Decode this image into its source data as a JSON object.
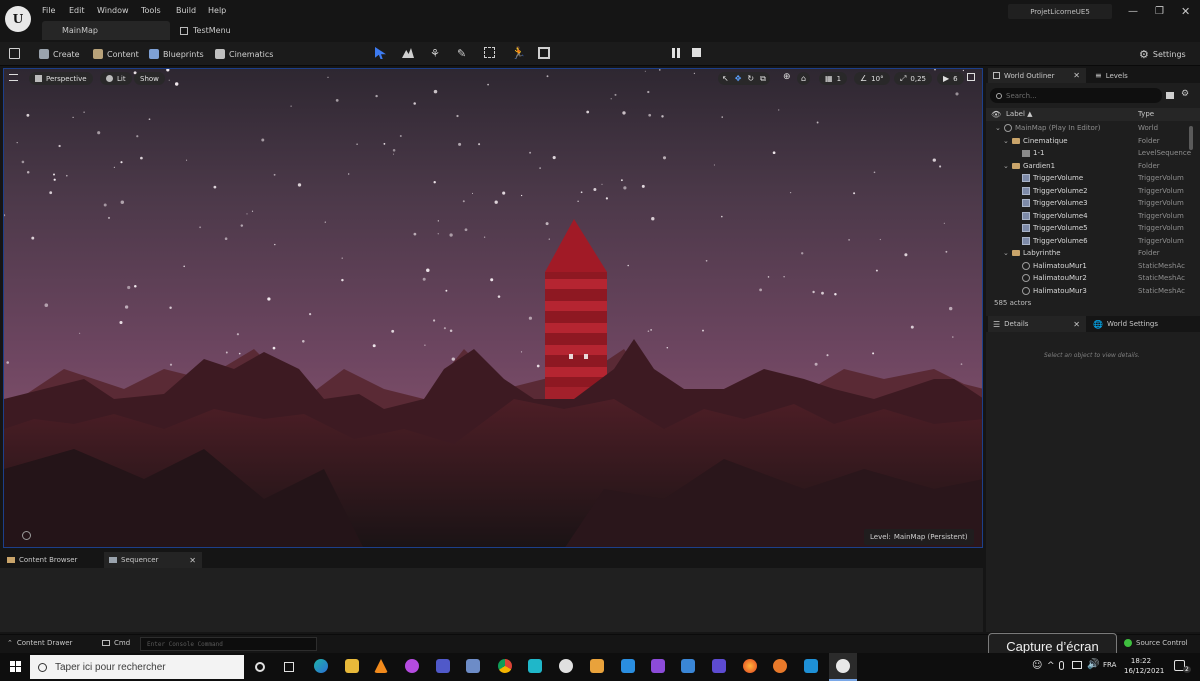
{
  "titlebar": {
    "menu": [
      "File",
      "Edit",
      "Window",
      "Tools",
      "Build",
      "Help"
    ],
    "project_name": "ProjetLicorneUE5",
    "tabs": [
      "MainMap",
      "TestMenu"
    ]
  },
  "toolbar": {
    "create": "Create",
    "content": "Content",
    "blueprints": "Blueprints",
    "cinematics": "Cinematics",
    "settings": "Settings"
  },
  "viewport": {
    "perspective": "Perspective",
    "lit": "Lit",
    "show": "Show",
    "grid_snap": "1",
    "rotation_snap": "10°",
    "scale_snap": "0,25",
    "camera_speed": "6",
    "level_label": "Level:",
    "level_value": "MainMap (Persistent)"
  },
  "outliner": {
    "tab_outliner": "World Outliner",
    "tab_levels": "Levels",
    "search_placeholder": "Search...",
    "col_label": "Label ▲",
    "col_type": "Type",
    "rows": [
      {
        "label": "MainMap (Play In Editor)",
        "type": "World",
        "icon": "world-icon"
      },
      {
        "label": "Cinematique",
        "type": "Folder",
        "icon": "folder-icon"
      },
      {
        "label": "1-1",
        "type": "LevelSequence",
        "icon": "sequence-icon"
      },
      {
        "label": "Gardien1",
        "type": "Folder",
        "icon": "folder-icon"
      },
      {
        "label": "TriggerVolume",
        "type": "TriggerVolum",
        "icon": "trigger-volume-icon"
      },
      {
        "label": "TriggerVolume2",
        "type": "TriggerVolum",
        "icon": "trigger-volume-icon"
      },
      {
        "label": "TriggerVolume3",
        "type": "TriggerVolum",
        "icon": "trigger-volume-icon"
      },
      {
        "label": "TriggerVolume4",
        "type": "TriggerVolum",
        "icon": "trigger-volume-icon"
      },
      {
        "label": "TriggerVolume5",
        "type": "TriggerVolum",
        "icon": "trigger-volume-icon"
      },
      {
        "label": "TriggerVolume6",
        "type": "TriggerVolum",
        "icon": "trigger-volume-icon"
      },
      {
        "label": "Labyrinthe",
        "type": "Folder",
        "icon": "folder-icon"
      },
      {
        "label": "HalimatouMur1",
        "type": "StaticMeshAc",
        "icon": "static-mesh-icon"
      },
      {
        "label": "HalimatouMur2",
        "type": "StaticMeshAc",
        "icon": "static-mesh-icon"
      },
      {
        "label": "HalimatouMur3",
        "type": "StaticMeshAc",
        "icon": "static-mesh-icon"
      }
    ],
    "actor_count": "585 actors"
  },
  "details": {
    "tab_details": "Details",
    "tab_world_settings": "World Settings",
    "empty_message": "Select an object to view details."
  },
  "bottom": {
    "tab_content_browser": "Content Browser",
    "tab_sequencer": "Sequencer"
  },
  "statusbar": {
    "content_drawer": "Content Drawer",
    "cmd": "Cmd",
    "console_placeholder": "Enter Console Command",
    "source_control": "Source Control",
    "capture_tooltip": "Capture d’écran"
  },
  "taskbar": {
    "search_placeholder": "Taper ici pour rechercher",
    "language": "FRA",
    "time": "18:22",
    "date": "16/12/2021",
    "notification_count": "2"
  },
  "colors": {
    "accent": "#1c5fd6",
    "panel": "#1e1e1e",
    "sky_top": "#3a2e3c",
    "sky_bottom": "#7a4f6a",
    "tower_red": "#b3202c",
    "source_ok": "#3fbf3f"
  }
}
